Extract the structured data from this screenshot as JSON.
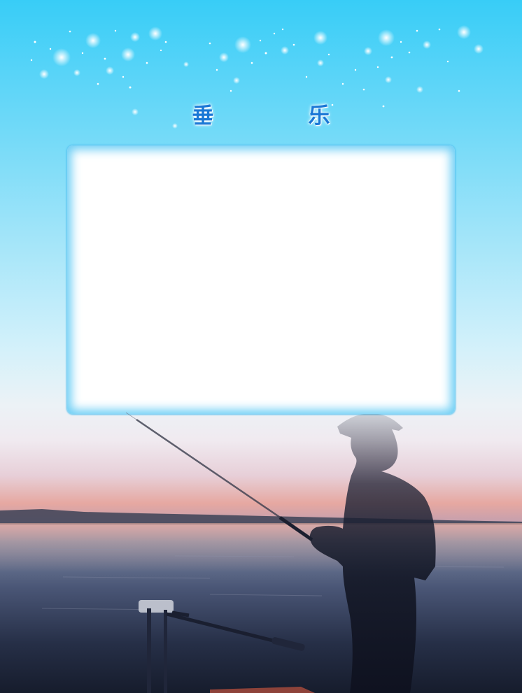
{
  "title": "垂　乐",
  "colors": {
    "sky_top": "#38cdf7",
    "title_text": "#1b78d6",
    "frame_border": "#6ccef5",
    "frame_fill": "#ffffff",
    "sunset": "#e6a8a1",
    "water_dark": "#161c2c"
  },
  "scene": {
    "sparkles": "sparkle-stars",
    "photo_slot": "blank-photo-frame",
    "illustration": "angler-silhouette-at-sunset"
  }
}
